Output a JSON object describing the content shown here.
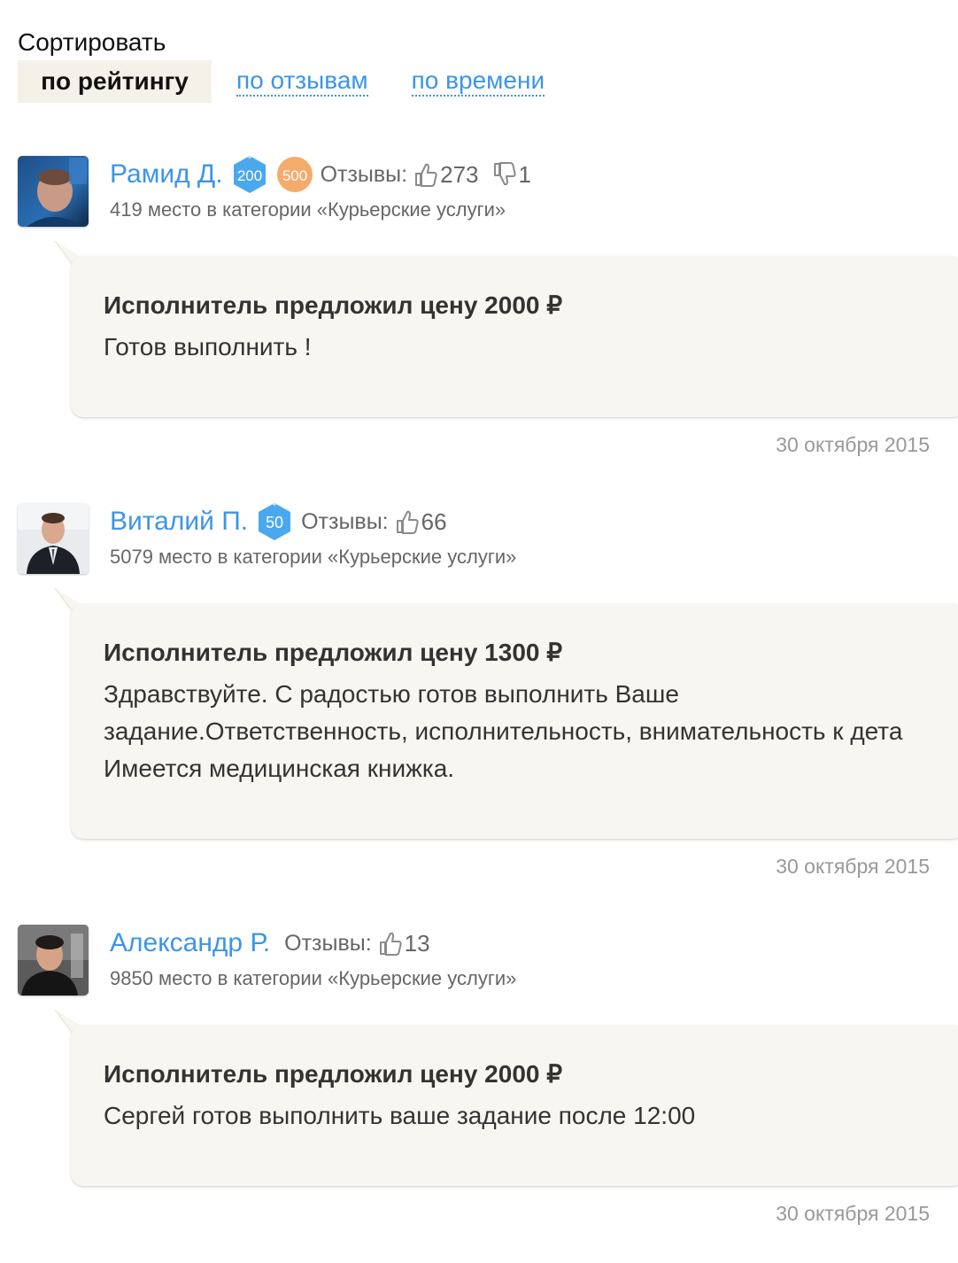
{
  "sort": {
    "label": "Сортировать",
    "active": "по рейтингу",
    "options": [
      "по отзывам",
      "по времени"
    ]
  },
  "performers": [
    {
      "name": "Рамид Д.",
      "badges": [
        {
          "value": "200",
          "icon": "blue-hexagon-badge-icon",
          "color": "#4aa8ee"
        },
        {
          "value": "500",
          "icon": "orange-circle-badge-icon",
          "color": "#f5ab6a"
        }
      ],
      "reviews_label": "Отзывы:",
      "positive": "273",
      "negative": "1",
      "rank": "419 место в категории «Курьерские услуги»",
      "offer_title": "Исполнитель предложил цену 2000 ₽",
      "offer_text": "Готов выполнить !",
      "date": "30 октября 2015"
    },
    {
      "name": "Виталий П.",
      "badges": [
        {
          "value": "50",
          "icon": "blue-hexagon-badge-icon",
          "color": "#4aa8ee"
        }
      ],
      "reviews_label": "Отзывы:",
      "positive": "66",
      "rank": "5079 место в категории «Курьерские услуги»",
      "offer_title": "Исполнитель предложил цену 1300 ₽",
      "offer_text": "Здравствуйте. С радостью готов выполнить Ваше\nзадание.Ответственность, исполнительность, внимательность к дета\nИмеется медицинская книжка.",
      "date": "30 октября 2015"
    },
    {
      "name": "Александр Р.",
      "badges": [],
      "reviews_label": "Отзывы:",
      "positive": "13",
      "rank": "9850 место в категории «Курьерские услуги»",
      "offer_title": "Исполнитель предложил цену 2000 ₽",
      "offer_text": "Сергей готов выполнить ваше задание после 12:00",
      "date": "30 октября 2015"
    }
  ],
  "colors": {
    "link": "#3c95e8",
    "bubble_bg": "#f8f6f0",
    "active_sort_bg": "#f4f1e8"
  }
}
